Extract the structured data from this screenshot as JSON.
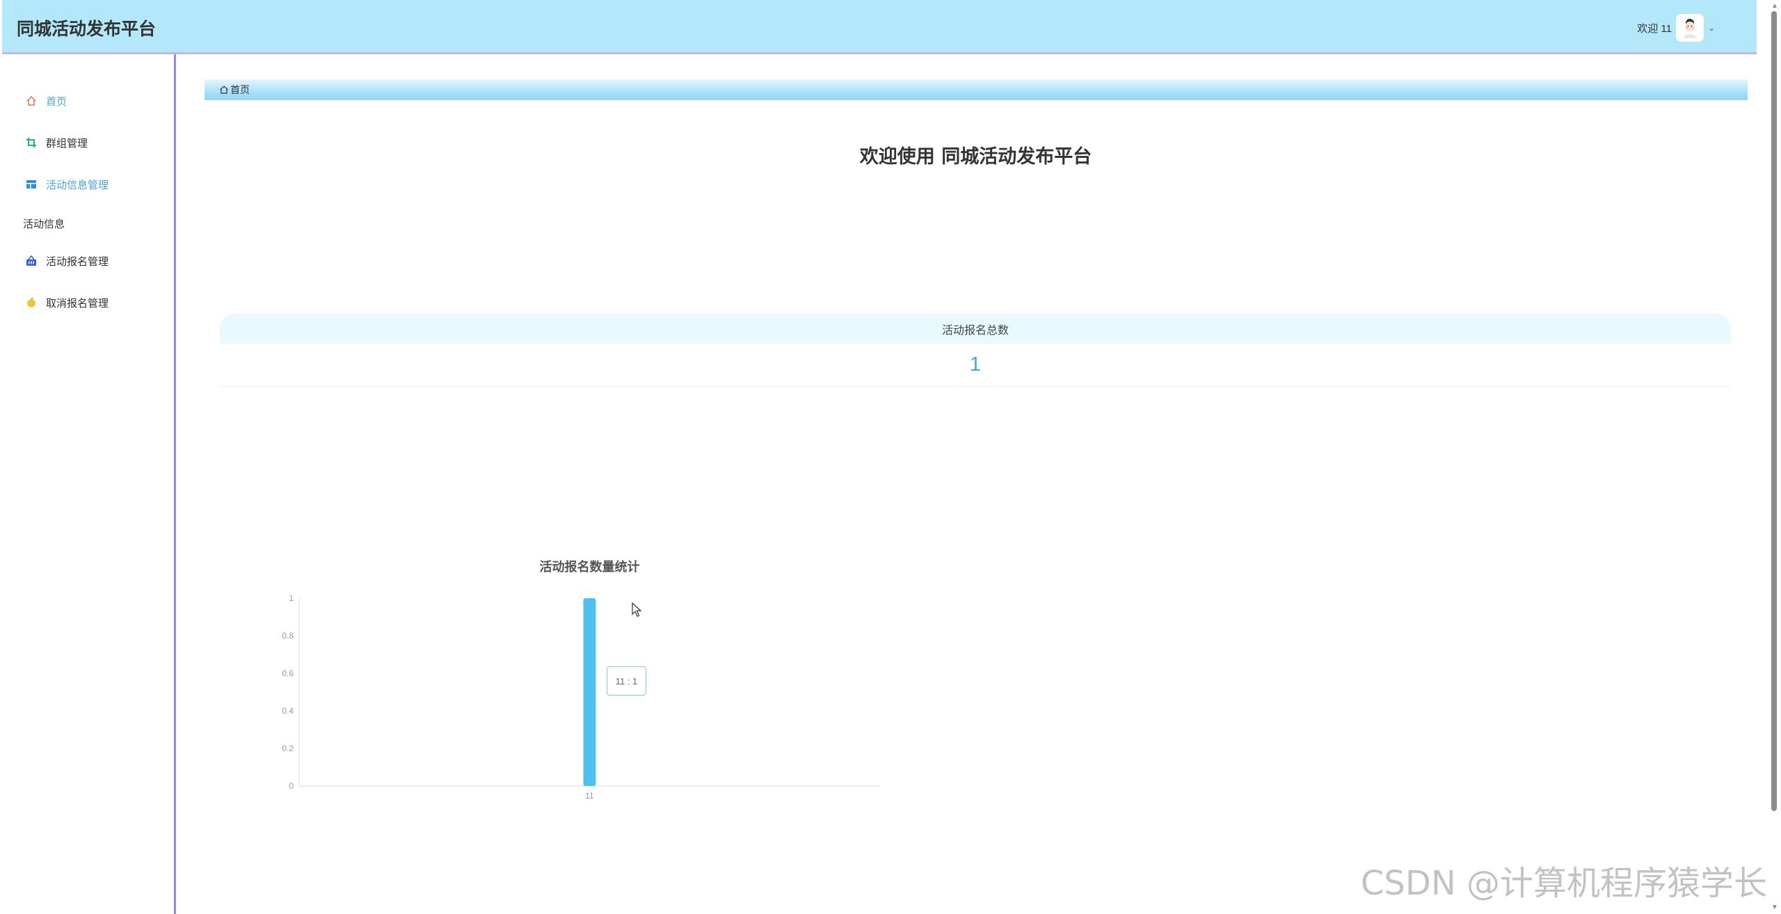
{
  "header": {
    "title": "同城活动发布平台",
    "welcome": "欢迎 11"
  },
  "sidebar": {
    "items": [
      {
        "label": "首页",
        "icon": "home-icon"
      },
      {
        "label": "群组管理",
        "icon": "crop-icon"
      },
      {
        "label": "活动信息管理",
        "icon": "table-icon"
      }
    ],
    "group_label": "活动信息",
    "sub_items": [
      {
        "label": "活动报名管理",
        "icon": "basket-icon"
      },
      {
        "label": "取消报名管理",
        "icon": "lemon-icon"
      }
    ]
  },
  "breadcrumb": {
    "label": "首页"
  },
  "page": {
    "title": "欢迎使用 同城活动发布平台"
  },
  "stat": {
    "label": "活动报名总数",
    "value": "1"
  },
  "chart_data": {
    "type": "bar",
    "title": "活动报名数量统计",
    "categories": [
      "11"
    ],
    "values": [
      1
    ],
    "ylim": [
      0,
      1
    ],
    "yticks": [
      "0",
      "0.2",
      "0.4",
      "0.6",
      "0.8",
      "1"
    ],
    "color": "#4fc0f0",
    "tooltip": "11 : 1"
  },
  "watermark": "CSDN @计算机程序猿学长",
  "colors": {
    "header_bg": "#b3e8fb",
    "accent": "#4aa4dc",
    "sidebar_border": "#9f86e0"
  }
}
